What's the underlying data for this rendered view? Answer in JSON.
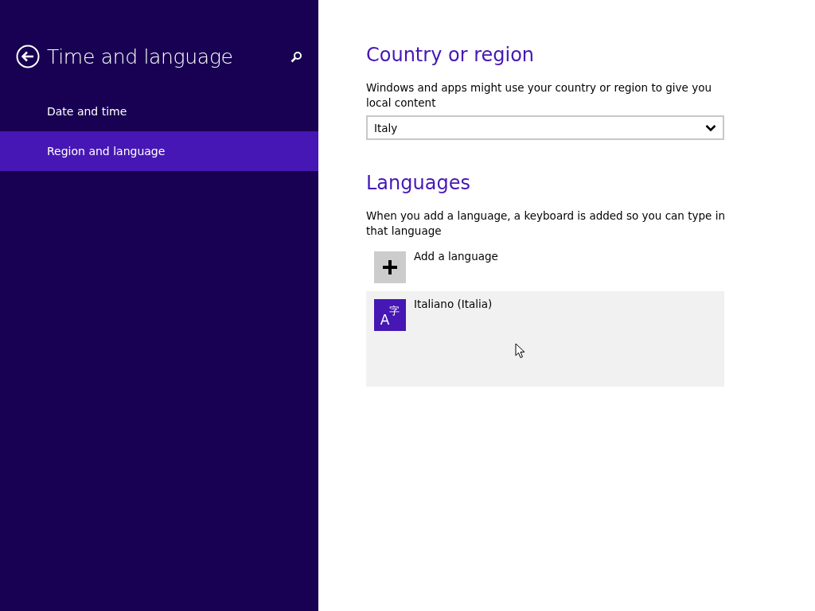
{
  "sidebar": {
    "title": "Time and language",
    "items": [
      {
        "label": "Date and time",
        "selected": false
      },
      {
        "label": "Region and language",
        "selected": true
      }
    ]
  },
  "country": {
    "heading": "Country or region",
    "description": "Windows and apps might use your country or region to give you local content",
    "value": "Italy"
  },
  "languages": {
    "heading": "Languages",
    "description": "When you add a language, a keyboard is added so you can type in that language",
    "items": [
      {
        "kind": "add",
        "label": "Add a language",
        "selected": false
      },
      {
        "kind": "language",
        "label": "Italiano (Italia)",
        "icon_letter": "A",
        "icon_char": "字",
        "selected": true
      }
    ]
  }
}
